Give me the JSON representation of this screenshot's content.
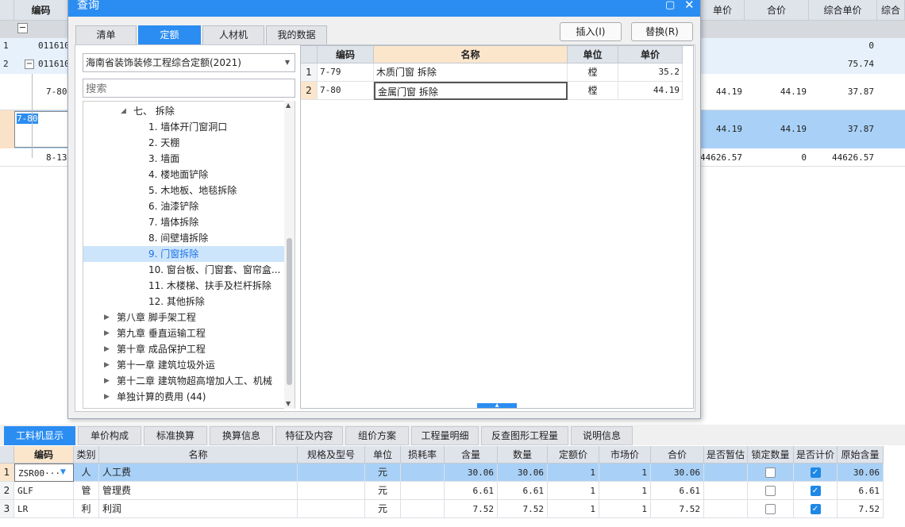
{
  "background": {
    "headers": [
      "编码",
      "单价",
      "合价",
      "综合单价",
      "综合"
    ],
    "rows": [
      {
        "num": "1",
        "code": "011610",
        "price": "",
        "total": "",
        "comp": "0"
      },
      {
        "num": "2",
        "code": "011610",
        "price": "",
        "total": "",
        "comp": "75.74"
      },
      {
        "num": "",
        "code": "7-80",
        "price": "44.19",
        "total": "44.19",
        "comp": "37.87"
      },
      {
        "num": "",
        "code": "7-80",
        "price": "44.19",
        "total": "44.19",
        "comp": "37.87"
      },
      {
        "num": "",
        "code": "8-13",
        "price": "44626.57",
        "total": "0",
        "comp": "44626.57"
      }
    ]
  },
  "dialog": {
    "title": "查询",
    "tabs": [
      "清单",
      "定额",
      "人材机",
      "我的数据"
    ],
    "insert_button": "插入(I)",
    "replace_button": "替换(R)",
    "library": "海南省装饰装修工程综合定额(2021)",
    "search_placeholder": "搜索",
    "tree": [
      {
        "label": "七、 拆除",
        "level": 1,
        "expanded": true
      },
      {
        "label": "1. 墙体开门窗洞口",
        "level": 2
      },
      {
        "label": "2. 天棚",
        "level": 2
      },
      {
        "label": "3. 墙面",
        "level": 2
      },
      {
        "label": "4. 楼地面铲除",
        "level": 2
      },
      {
        "label": "5. 木地板、地毯拆除",
        "level": 2
      },
      {
        "label": "6. 油漆铲除",
        "level": 2
      },
      {
        "label": "7. 墙体拆除",
        "level": 2
      },
      {
        "label": "8. 间壁墙拆除",
        "level": 2
      },
      {
        "label": "9. 门窗拆除",
        "level": 2,
        "selected": true
      },
      {
        "label": "10. 窗台板、门窗套、窗帘盒...",
        "level": 2
      },
      {
        "label": "11. 木楼梯、扶手及栏杆拆除",
        "level": 2
      },
      {
        "label": "12. 其他拆除",
        "level": 2
      },
      {
        "label": "第八章 脚手架工程",
        "level": 0
      },
      {
        "label": "第九章 垂直运输工程",
        "level": 0
      },
      {
        "label": "第十章 成品保护工程",
        "level": 0
      },
      {
        "label": "第十一章 建筑垃圾外运",
        "level": 0
      },
      {
        "label": "第十二章 建筑物超高增加人工、机械",
        "level": 0
      },
      {
        "label": "单独计算的费用 (44)",
        "level": 0
      }
    ],
    "grid_headers": [
      "编码",
      "名称",
      "单位",
      "单价"
    ],
    "grid_rows": [
      {
        "num": "1",
        "code": "7-79",
        "name": "木质门窗 拆除",
        "unit": "樘",
        "price": "35.2"
      },
      {
        "num": "2",
        "code": "7-80",
        "name": "金属门窗 拆除",
        "unit": "樘",
        "price": "44.19"
      }
    ]
  },
  "bottom": {
    "tabs": [
      "工料机显示",
      "单价构成",
      "标准换算",
      "换算信息",
      "特征及内容",
      "组价方案",
      "工程量明细",
      "反查图形工程量",
      "说明信息"
    ],
    "headers": [
      "编码",
      "类别",
      "名称",
      "规格及型号",
      "单位",
      "损耗率",
      "含量",
      "数量",
      "定额价",
      "市场价",
      "合价",
      "是否暂估",
      "锁定数量",
      "是否计价",
      "原始含量"
    ],
    "rows": [
      {
        "num": "1",
        "code": "ZSR00···",
        "type": "人",
        "name": "人工费",
        "spec": "",
        "unit": "元",
        "loss": "",
        "qty": "30.06",
        "amount": "30.06",
        "quota": "1",
        "market": "1",
        "total": "30.06",
        "lock": false,
        "priced": true,
        "orig": "30.06"
      },
      {
        "num": "2",
        "code": "GLF",
        "type": "管",
        "name": "管理费",
        "spec": "",
        "unit": "元",
        "loss": "",
        "qty": "6.61",
        "amount": "6.61",
        "quota": "1",
        "market": "1",
        "total": "6.61",
        "lock": false,
        "priced": true,
        "orig": "6.61"
      },
      {
        "num": "3",
        "code": "LR",
        "type": "利",
        "name": "利润",
        "spec": "",
        "unit": "元",
        "loss": "",
        "qty": "7.52",
        "amount": "7.52",
        "quota": "1",
        "market": "1",
        "total": "7.52",
        "lock": false,
        "priced": true,
        "orig": "7.52"
      }
    ]
  },
  "colors": {
    "accent": "#2b8df2",
    "selection": "#a9d1f7",
    "header": "#dfe3ea"
  },
  "icons": [
    "close-icon",
    "maximize-icon",
    "dropdown-arrow-icon",
    "tree-collapse-icon",
    "tree-expand-icon",
    "checkbox-icon"
  ]
}
